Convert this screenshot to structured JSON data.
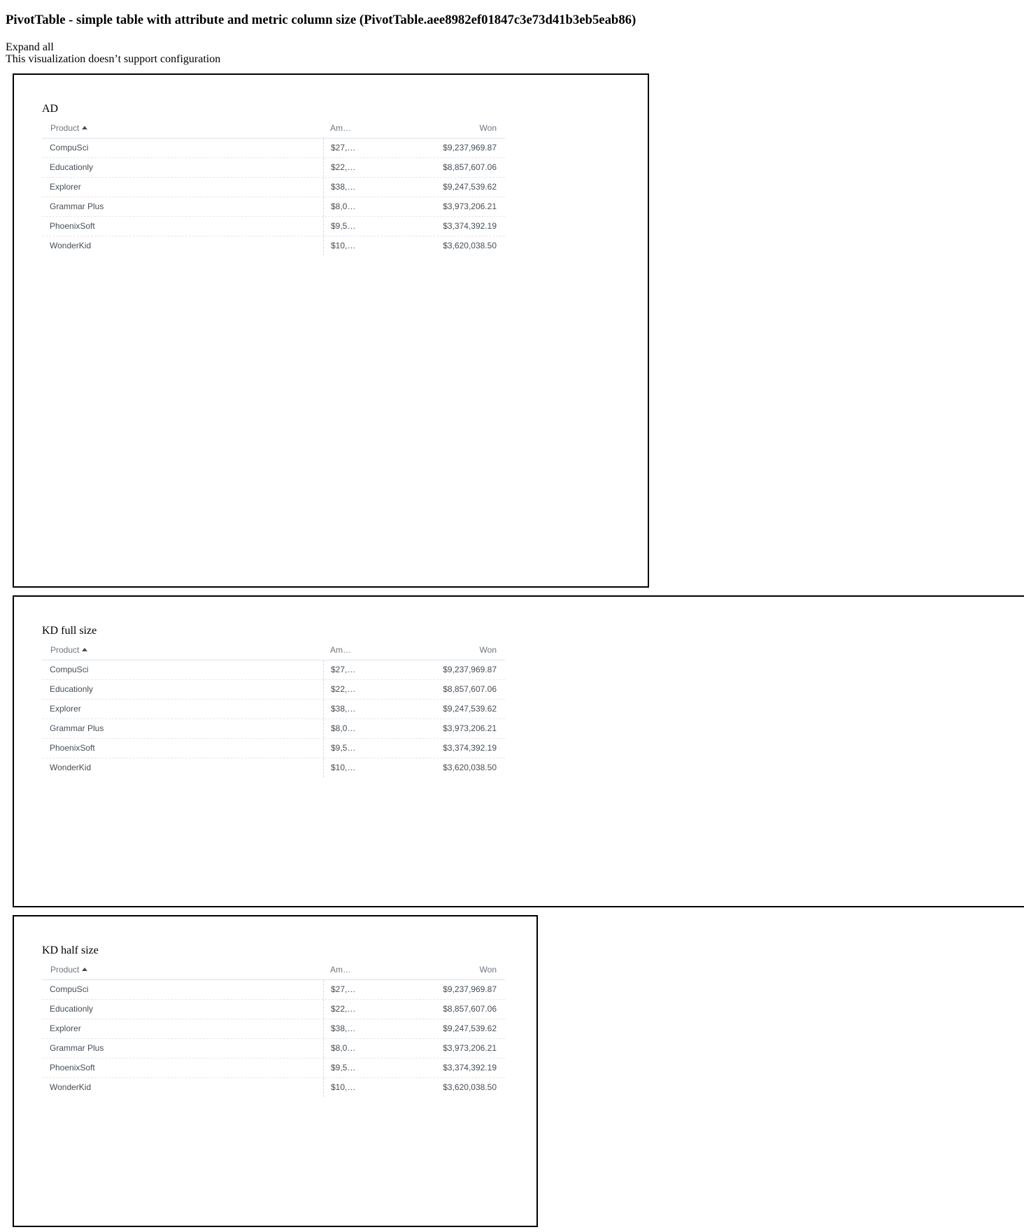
{
  "page": {
    "title": "PivotTable - simple table with attribute and metric column size (PivotTable.aee8982ef01847c3e73d41b3eb5eab86)",
    "expand_all": "Expand all",
    "config_note": "This visualization doesn’t support configuration"
  },
  "headers": {
    "product": "Product",
    "amount": "Am…",
    "won": "Won"
  },
  "visualizations": [
    {
      "title": "AD",
      "rows": [
        {
          "product": "CompuSci",
          "amount": "$27,…",
          "won": "$9,237,969.87"
        },
        {
          "product": "Educationly",
          "amount": "$22,…",
          "won": "$8,857,607.06"
        },
        {
          "product": "Explorer",
          "amount": "$38,…",
          "won": "$9,247,539.62"
        },
        {
          "product": "Grammar Plus",
          "amount": "$8,0…",
          "won": "$3,973,206.21"
        },
        {
          "product": "PhoenixSoft",
          "amount": "$9,5…",
          "won": "$3,374,392.19"
        },
        {
          "product": "WonderKid",
          "amount": "$10,…",
          "won": "$3,620,038.50"
        }
      ]
    },
    {
      "title": "KD full size",
      "rows": [
        {
          "product": "CompuSci",
          "amount": "$27,…",
          "won": "$9,237,969.87"
        },
        {
          "product": "Educationly",
          "amount": "$22,…",
          "won": "$8,857,607.06"
        },
        {
          "product": "Explorer",
          "amount": "$38,…",
          "won": "$9,247,539.62"
        },
        {
          "product": "Grammar Plus",
          "amount": "$8,0…",
          "won": "$3,973,206.21"
        },
        {
          "product": "PhoenixSoft",
          "amount": "$9,5…",
          "won": "$3,374,392.19"
        },
        {
          "product": "WonderKid",
          "amount": "$10,…",
          "won": "$3,620,038.50"
        }
      ]
    },
    {
      "title": "KD half size",
      "rows": [
        {
          "product": "CompuSci",
          "amount": "$27,…",
          "won": "$9,237,969.87"
        },
        {
          "product": "Educationly",
          "amount": "$22,…",
          "won": "$8,857,607.06"
        },
        {
          "product": "Explorer",
          "amount": "$38,…",
          "won": "$9,247,539.62"
        },
        {
          "product": "Grammar Plus",
          "amount": "$8,0…",
          "won": "$3,973,206.21"
        },
        {
          "product": "PhoenixSoft",
          "amount": "$9,5…",
          "won": "$3,374,392.19"
        },
        {
          "product": "WonderKid",
          "amount": "$10,…",
          "won": "$3,620,038.50"
        }
      ]
    }
  ]
}
